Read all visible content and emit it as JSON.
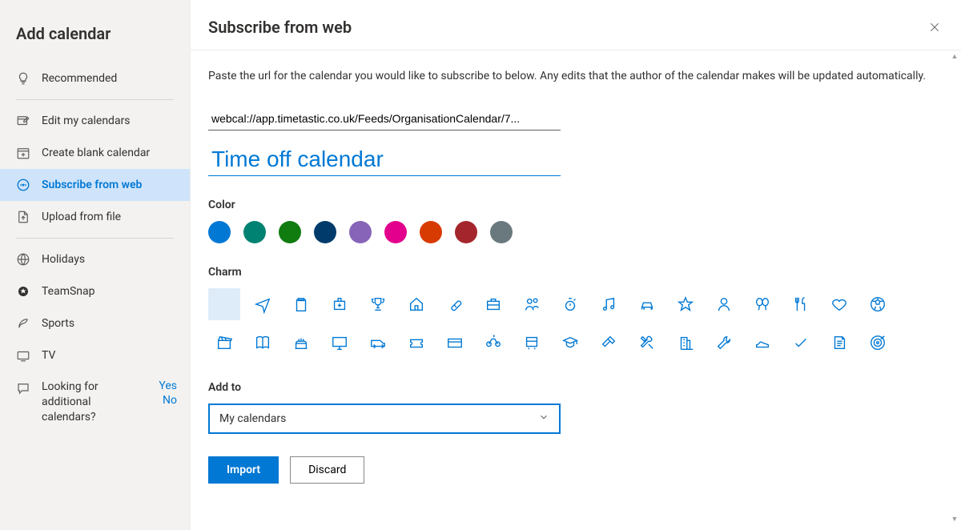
{
  "sidebar": {
    "title": "Add calendar",
    "items": [
      {
        "label": "Recommended",
        "icon": "lightbulb-icon"
      },
      {
        "label": "Edit my calendars",
        "icon": "edit-calendar-icon"
      },
      {
        "label": "Create blank calendar",
        "icon": "new-calendar-icon"
      },
      {
        "label": "Subscribe from web",
        "icon": "subscribe-web-icon"
      },
      {
        "label": "Upload from file",
        "icon": "upload-file-icon"
      },
      {
        "label": "Holidays",
        "icon": "globe-icon"
      },
      {
        "label": "TeamSnap",
        "icon": "teamsnap-icon"
      },
      {
        "label": "Sports",
        "icon": "sports-icon"
      },
      {
        "label": "TV",
        "icon": "tv-icon"
      }
    ],
    "footer": {
      "text": "Looking for additional calendars?",
      "yes": "Yes",
      "no": "No"
    }
  },
  "main": {
    "title": "Subscribe from web",
    "description": "Paste the url for the calendar you would like to subscribe to below. Any edits that the author of the calendar makes will be updated automatically.",
    "url_value": "webcal://app.timetastic.co.uk/Feeds/OrganisationCalendar/7...",
    "name_value": "Time off calendar",
    "color_label": "Color",
    "colors": [
      "#0078d4",
      "#008272",
      "#107c10",
      "#003b6b",
      "#8764b8",
      "#e3008c",
      "#d83b01",
      "#a4262c",
      "#69797e"
    ],
    "charm_label": "Charm",
    "charms_row1": [
      "none",
      "airplane",
      "clipboard",
      "first-aid",
      "trophy",
      "home",
      "pill",
      "briefcase",
      "people",
      "stopwatch",
      "music",
      "car",
      "star",
      "person",
      "balloons",
      "utensils",
      "heart",
      "soccer"
    ],
    "charms_row2": [
      "clapboard",
      "book",
      "cake",
      "monitor",
      "van",
      "ticket",
      "card",
      "bike",
      "bus",
      "graduation",
      "hammer",
      "tools",
      "building",
      "wrench",
      "shoe",
      "checkmark",
      "notepad",
      "target"
    ],
    "addto_label": "Add to",
    "addto_value": "My calendars",
    "import_label": "Import",
    "discard_label": "Discard"
  }
}
